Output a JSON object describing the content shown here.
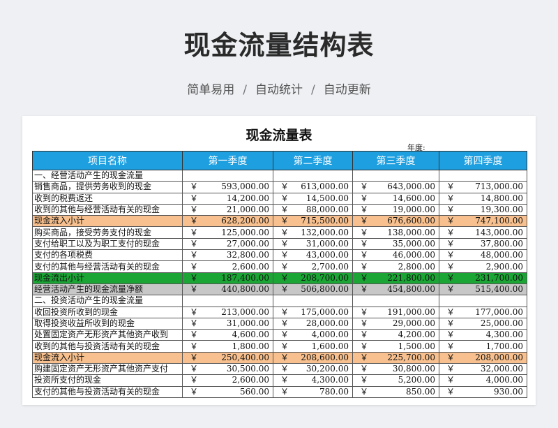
{
  "header": {
    "title": "现金流量结构表",
    "tagline": [
      "简单易用",
      "自动统计",
      "自动更新"
    ],
    "separator": "/"
  },
  "sheet": {
    "title": "现金流量表",
    "year_label": "年度:",
    "currency_symbol": "￥",
    "columns": [
      "项目名称",
      "第一季度",
      "第二季度",
      "第三季度",
      "第四季度"
    ],
    "rows": [
      {
        "label": "一、经营活动产生的现金流量",
        "type": "section",
        "values": []
      },
      {
        "label": "销售商品，提供劳务收到的现金",
        "type": "item",
        "values": [
          "593,000.00",
          "613,000.00",
          "643,000.00",
          "713,000.00"
        ]
      },
      {
        "label": "收到的税费返还",
        "type": "item",
        "values": [
          "14,200.00",
          "14,500.00",
          "14,600.00",
          "14,800.00"
        ]
      },
      {
        "label": "收到的其他与经营活动有关的现金",
        "type": "item",
        "values": [
          "21,000.00",
          "88,000.00",
          "19,000.00",
          "19,300.00"
        ]
      },
      {
        "label": "现金流入小计",
        "type": "inflow",
        "values": [
          "628,200.00",
          "715,500.00",
          "676,600.00",
          "747,100.00"
        ]
      },
      {
        "label": "购买商品，接受劳务支付的现金",
        "type": "item",
        "values": [
          "125,000.00",
          "132,000.00",
          "138,000.00",
          "143,000.00"
        ]
      },
      {
        "label": "支付给职工以及为职工支付的现金",
        "type": "item",
        "values": [
          "27,000.00",
          "31,000.00",
          "35,000.00",
          "37,800.00"
        ]
      },
      {
        "label": "支付的各项税费",
        "type": "item",
        "values": [
          "32,800.00",
          "43,000.00",
          "46,000.00",
          "48,000.00"
        ]
      },
      {
        "label": "支付的其他与经营活动有关的现金",
        "type": "item",
        "values": [
          "2,600.00",
          "2,700.00",
          "2,800.00",
          "2,900.00"
        ]
      },
      {
        "label": "现金流出小计",
        "type": "outflow",
        "values": [
          "187,400.00",
          "208,700.00",
          "221,800.00",
          "231,700.00"
        ]
      },
      {
        "label": "经营活动产生的现金流量净额",
        "type": "net",
        "values": [
          "440,800.00",
          "506,800.00",
          "454,800.00",
          "515,400.00"
        ]
      },
      {
        "label": "二、投资活动产生的现金流量",
        "type": "section",
        "values": []
      },
      {
        "label": "收回投资所收到的现金",
        "type": "item",
        "values": [
          "213,000.00",
          "175,000.00",
          "191,000.00",
          "177,000.00"
        ]
      },
      {
        "label": "取得投资收益所收到的现金",
        "type": "item",
        "values": [
          "31,000.00",
          "28,000.00",
          "29,000.00",
          "25,000.00"
        ]
      },
      {
        "label": "处置固定资产无形资产其他资产收到",
        "type": "item",
        "values": [
          "4,600.00",
          "4,000.00",
          "4,200.00",
          "4,300.00"
        ]
      },
      {
        "label": "收到的其他与投资活动有关的现金",
        "type": "item",
        "values": [
          "1,800.00",
          "1,600.00",
          "1,500.00",
          "1,700.00"
        ]
      },
      {
        "label": "现金流入小计",
        "type": "inflow",
        "values": [
          "250,400.00",
          "208,600.00",
          "225,700.00",
          "208,000.00"
        ]
      },
      {
        "label": "购建固定资产无形资产其他资产支付",
        "type": "item",
        "values": [
          "30,500.00",
          "30,200.00",
          "30,800.00",
          "32,000.00"
        ]
      },
      {
        "label": "投资所支付的现金",
        "type": "item",
        "values": [
          "2,600.00",
          "4,300.00",
          "5,200.00",
          "4,000.00"
        ]
      },
      {
        "label": "支付的其他与投资活动有关的现金",
        "type": "item",
        "values": [
          "560.00",
          "780.00",
          "850.00",
          "930.00"
        ]
      }
    ]
  },
  "colors": {
    "header_blue": "#1e9fe0",
    "inflow_orange": "#f7c08e",
    "outflow_green": "#1aa535",
    "net_gray": "#c7c7c7"
  }
}
